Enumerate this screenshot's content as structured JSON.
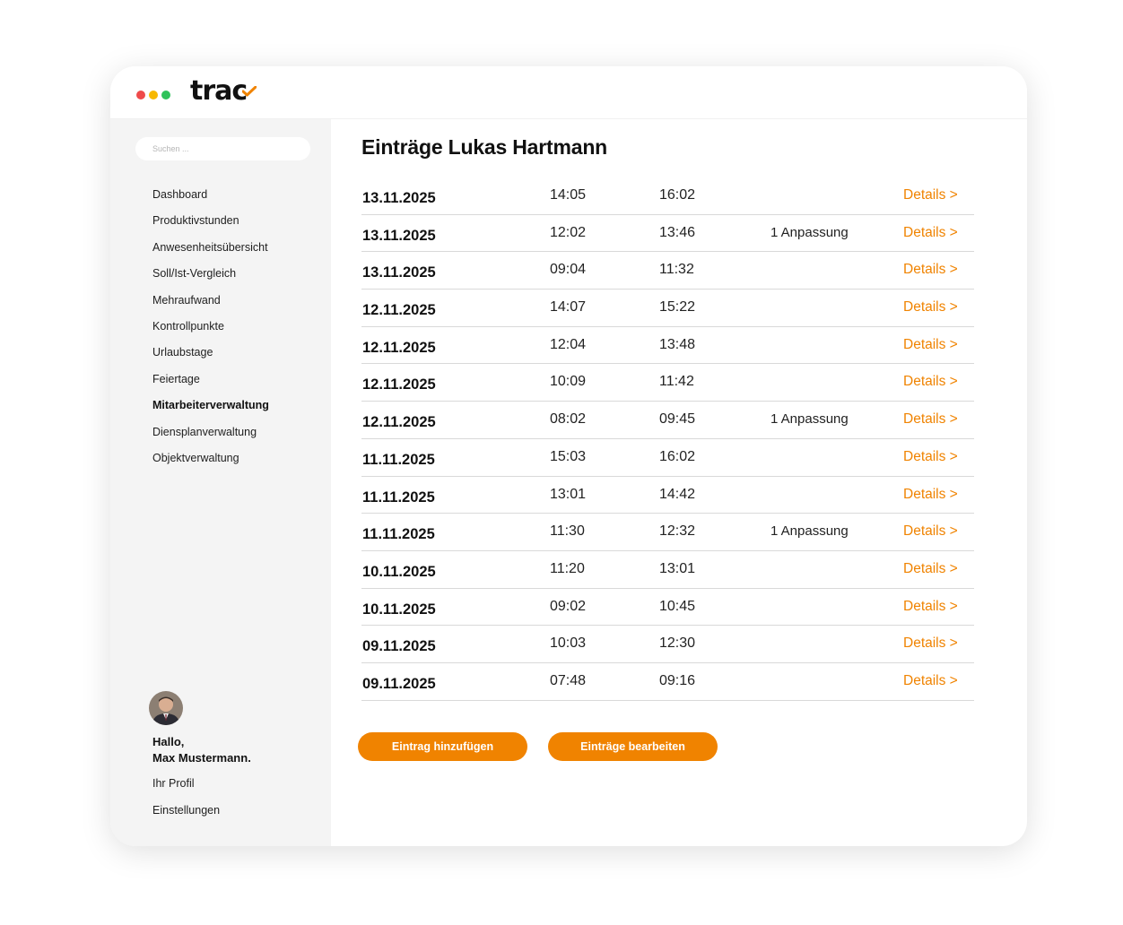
{
  "app": {
    "name": "trac",
    "colors": {
      "accent": "#f08300",
      "sidebar_bg": "#f4f4f4",
      "dot_red": "#ef4b4b",
      "dot_yellow": "#f7b800",
      "dot_green": "#2fc25a"
    }
  },
  "sidebar": {
    "search_placeholder": "Suchen ...",
    "items": [
      {
        "label": "Dashboard"
      },
      {
        "label": "Produktivstunden"
      },
      {
        "label": "Anwesenheitsübersicht"
      },
      {
        "label": "Soll/Ist-Vergleich"
      },
      {
        "label": "Mehraufwand"
      },
      {
        "label": "Kontrollpunkte"
      },
      {
        "label": "Urlaubstage"
      },
      {
        "label": "Feiertage"
      },
      {
        "label": "Mitarbeiterverwaltung",
        "active": true
      },
      {
        "label": "Diensplanverwaltung"
      },
      {
        "label": "Objektverwaltung"
      }
    ],
    "user": {
      "greeting_line1": "Hallo,",
      "greeting_line2": "Max Mustermann.",
      "profile_link": "Ihr Profil",
      "settings_link": "Einstellungen"
    }
  },
  "main": {
    "title": "Einträge Lukas Hartmann",
    "entries": [
      {
        "date": "13.11.2025",
        "start": "14:05",
        "end": "16:02",
        "note": "",
        "link": "Details >"
      },
      {
        "date": "13.11.2025",
        "start": "12:02",
        "end": "13:46",
        "note": "1 Anpassung",
        "link": "Details >"
      },
      {
        "date": "13.11.2025",
        "start": "09:04",
        "end": "11:32",
        "note": "",
        "link": "Details >"
      },
      {
        "date": "12.11.2025",
        "start": "14:07",
        "end": "15:22",
        "note": "",
        "link": "Details >"
      },
      {
        "date": "12.11.2025",
        "start": "12:04",
        "end": "13:48",
        "note": "",
        "link": "Details >"
      },
      {
        "date": "12.11.2025",
        "start": "10:09",
        "end": "11:42",
        "note": "",
        "link": "Details >"
      },
      {
        "date": "12.11.2025",
        "start": "08:02",
        "end": "09:45",
        "note": "1 Anpassung",
        "link": "Details >"
      },
      {
        "date": "11.11.2025",
        "start": "15:03",
        "end": "16:02",
        "note": "",
        "link": "Details >"
      },
      {
        "date": "11.11.2025",
        "start": "13:01",
        "end": "14:42",
        "note": "",
        "link": "Details >"
      },
      {
        "date": "11.11.2025",
        "start": "11:30",
        "end": "12:32",
        "note": "1 Anpassung",
        "link": "Details >"
      },
      {
        "date": "10.11.2025",
        "start": "11:20",
        "end": "13:01",
        "note": "",
        "link": "Details >"
      },
      {
        "date": "10.11.2025",
        "start": "09:02",
        "end": "10:45",
        "note": "",
        "link": "Details >"
      },
      {
        "date": "09.11.2025",
        "start": "10:03",
        "end": "12:30",
        "note": "",
        "link": "Details >"
      },
      {
        "date": "09.11.2025",
        "start": "07:48",
        "end": "09:16",
        "note": "",
        "link": "Details >"
      }
    ],
    "buttons": {
      "add": "Eintrag hinzufügen",
      "edit": "Einträge bearbeiten"
    }
  }
}
